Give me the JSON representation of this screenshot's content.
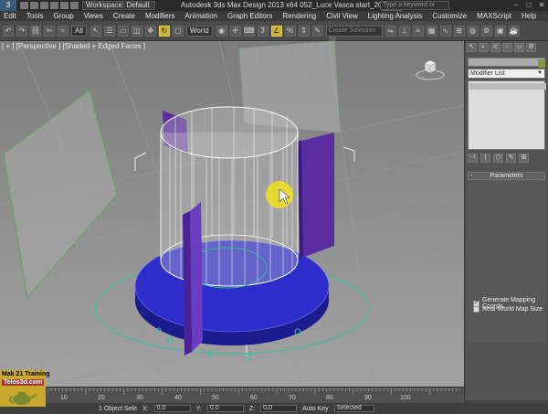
{
  "titlebar": {
    "logo": "3",
    "workspace": "Workspace: Default",
    "title": "Autodesk 3ds Max Design 2013 x64     052_Luce Vasca start_2013.max",
    "search_placeholder": "Type a keyword or phrase",
    "minimize": "–",
    "maximize": "□",
    "close": "✕"
  },
  "menu": [
    "Edit",
    "Tools",
    "Group",
    "Views",
    "Create",
    "Modifiers",
    "Animation",
    "Graph Editors",
    "Rendering",
    "Civil View",
    "Lighting Analysis",
    "Customize",
    "MAXScript",
    "Help"
  ],
  "toolbar": {
    "filter_value": "All",
    "coord_value": "World",
    "selection_set_placeholder": "Create Selection Se"
  },
  "viewport": {
    "label": "[ + ] [Perspective ] [Shaded + Edged Faces ]"
  },
  "command_panel": {
    "tabs": [
      "↖",
      "◐",
      "⊂",
      "○",
      "▭",
      "⚙"
    ],
    "modifier_list": "Modifier List",
    "stack_buttons": [
      "⊣",
      "|",
      "⬡",
      "✎",
      "⊞"
    ],
    "rollout_title": "Parameters",
    "checkboxes": [
      {
        "label": "Generate Mapping Coords.",
        "checked": true
      },
      {
        "label": "Real-World Map Size",
        "checked": false
      }
    ],
    "accent_color": "#7f9a3d"
  },
  "watermark": {
    "line1": "Mak 21 Training",
    "line2": "Telos3d.com"
  },
  "timeline": {
    "ticks": [
      "10",
      "20",
      "30",
      "40",
      "50",
      "60",
      "70",
      "80",
      "90",
      "100"
    ]
  },
  "statusbar": {
    "object_count": "1 Object Sele",
    "x_label": "X:",
    "x_value": "0,0",
    "y_label": "Y:",
    "y_value": "0,0",
    "z_label": "Z:",
    "z_value": "0,0",
    "auto_key": "Auto Key",
    "key_mode": "Selected"
  }
}
